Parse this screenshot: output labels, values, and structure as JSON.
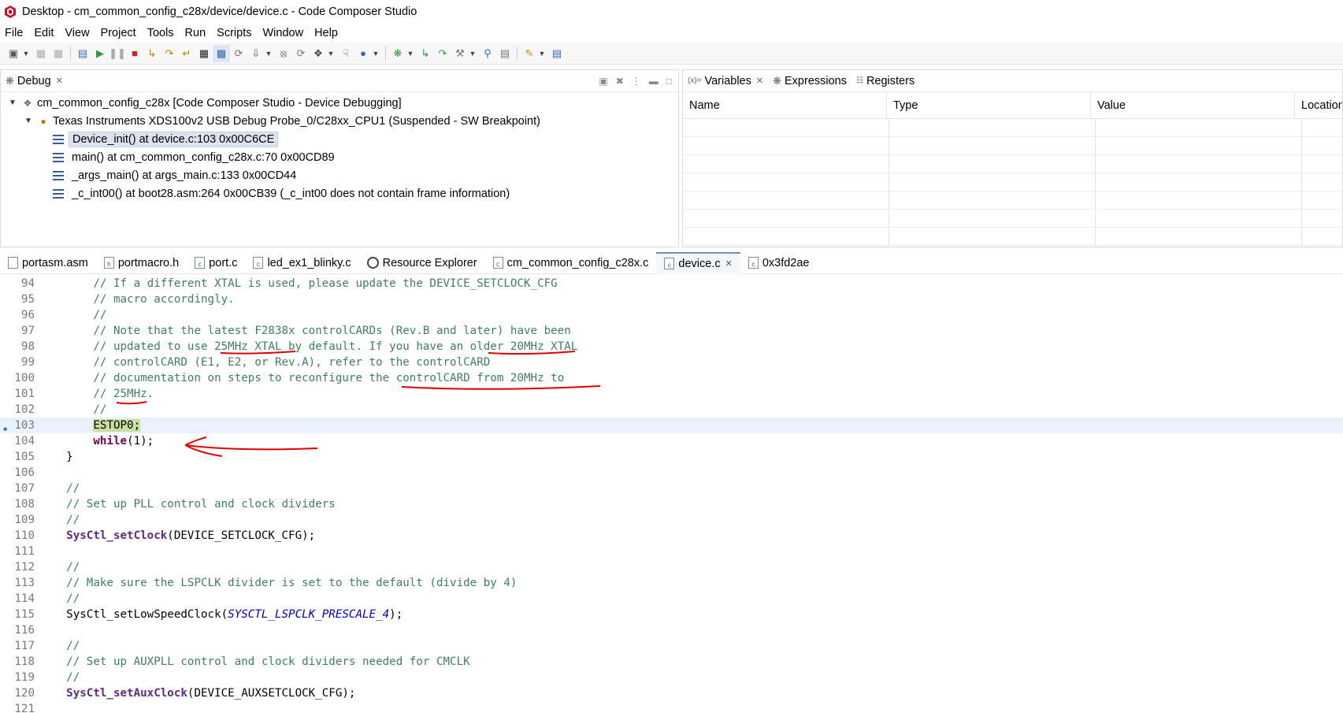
{
  "window": {
    "title": "Desktop - cm_common_config_c28x/device/device.c - Code Composer Studio"
  },
  "menu": [
    "File",
    "Edit",
    "View",
    "Project",
    "Tools",
    "Run",
    "Scripts",
    "Window",
    "Help"
  ],
  "debug_panel": {
    "tab_label": "Debug",
    "session": "cm_common_config_c28x [Code Composer Studio - Device Debugging]",
    "target": "Texas Instruments XDS100v2 USB Debug Probe_0/C28xx_CPU1 (Suspended - SW Breakpoint)",
    "frames": [
      {
        "label": "Device_init() at device.c:103 0x00C6CE",
        "selected": true
      },
      {
        "label": "main() at cm_common_config_c28x.c:70 0x00CD89",
        "selected": false
      },
      {
        "label": "_args_main() at args_main.c:133 0x00CD44",
        "selected": false
      },
      {
        "label": "_c_int00() at boot28.asm:264 0x00CB39  (_c_int00 does not contain frame information)",
        "selected": false
      }
    ]
  },
  "vars_panel": {
    "tabs": [
      {
        "label": "Variables",
        "icon": "variables-icon"
      },
      {
        "label": "Expressions",
        "icon": "expressions-icon"
      },
      {
        "label": "Registers",
        "icon": "registers-icon"
      }
    ],
    "columns": [
      "Name",
      "Type",
      "Value",
      "Location"
    ]
  },
  "editor_tabs": [
    {
      "label": "portasm.asm",
      "active": false
    },
    {
      "label": "portmacro.h",
      "active": false
    },
    {
      "label": "port.c",
      "active": false
    },
    {
      "label": "led_ex1_blinky.c",
      "active": false
    },
    {
      "label": "Resource Explorer",
      "active": false
    },
    {
      "label": "cm_common_config_c28x.c",
      "active": false
    },
    {
      "label": "device.c",
      "active": true
    },
    {
      "label": "0x3fd2ae",
      "active": false
    }
  ],
  "code": {
    "current_line": 103,
    "lines": [
      {
        "n": "94",
        "t": "        // If a different XTAL is used, please update the DEVICE_SETCLOCK_CFG"
      },
      {
        "n": "95",
        "t": "        // macro accordingly."
      },
      {
        "n": "96",
        "t": "        //"
      },
      {
        "n": "97",
        "t": "        // Note that the latest F2838x controlCARDs (Rev.B and later) have been"
      },
      {
        "n": "98",
        "t": "        // updated to use 25MHz XTAL by default. If you have an older 20MHz XTAL"
      },
      {
        "n": "99",
        "t": "        // controlCARD (E1, E2, or Rev.A), refer to the controlCARD"
      },
      {
        "n": "100",
        "t": "        // documentation on steps to reconfigure the controlCARD from 20MHz to"
      },
      {
        "n": "101",
        "t": "        // 25MHz."
      },
      {
        "n": "102",
        "t": "        //"
      },
      {
        "n": "103",
        "t": "        ESTOP0;"
      },
      {
        "n": "104",
        "t": "        while(1);"
      },
      {
        "n": "105",
        "t": "    }"
      },
      {
        "n": "106",
        "t": ""
      },
      {
        "n": "107",
        "t": "    //"
      },
      {
        "n": "108",
        "t": "    // Set up PLL control and clock dividers"
      },
      {
        "n": "109",
        "t": "    //"
      },
      {
        "n": "110",
        "t": "    SysCtl_setClock(DEVICE_SETCLOCK_CFG);"
      },
      {
        "n": "111",
        "t": ""
      },
      {
        "n": "112",
        "t": "    //"
      },
      {
        "n": "113",
        "t": "    // Make sure the LSPCLK divider is set to the default (divide by 4)"
      },
      {
        "n": "114",
        "t": "    //"
      },
      {
        "n": "115",
        "t": "    SysCtl_setLowSpeedClock(SYSCTL_LSPCLK_PRESCALE_4);"
      },
      {
        "n": "116",
        "t": ""
      },
      {
        "n": "117",
        "t": "    //"
      },
      {
        "n": "118",
        "t": "    // Set up AUXPLL control and clock dividers needed for CMCLK"
      },
      {
        "n": "119",
        "t": "    //"
      },
      {
        "n": "120",
        "t": "    SysCtl_setAuxClock(DEVICE_AUXSETCLOCK_CFG);"
      },
      {
        "n": "121",
        "t": ""
      }
    ]
  },
  "colors": {
    "comment": "#3f7f5f",
    "keyword": "#7f0055",
    "function": "#642880",
    "constant": "#0000c0",
    "current_line_bg": "#e8f2fe",
    "annotation": "#e00000"
  }
}
